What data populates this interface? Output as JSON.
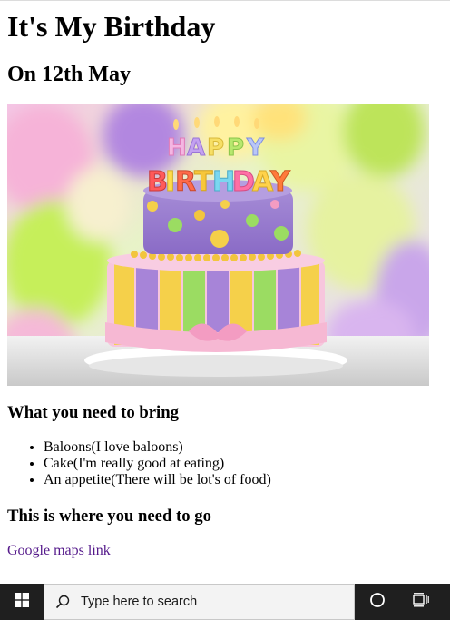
{
  "page": {
    "title": "It's My Birthday",
    "subtitle": "On 12th May",
    "image": {
      "alt": "Birthday cake with HAPPY BIRTHDAY candles",
      "candles_line1": "HAPPY",
      "candles_line2": "BIRTHDAY"
    },
    "bring_heading": "What you need to bring",
    "bring_items": [
      "Baloons(I love baloons)",
      "Cake(I'm really good at eating)",
      "An appetite(There will be lot's of food)"
    ],
    "go_heading": "This is where you need to go",
    "maps_link": "Google maps link"
  },
  "taskbar": {
    "search_placeholder": "Type here to search",
    "icons": [
      "windows-start-icon",
      "search-icon",
      "cortana-icon",
      "task-view-icon"
    ]
  },
  "colors": {
    "taskbar_bg": "#1f1f1f",
    "link_visited": "#551a8b",
    "search_bg": "#f3f3f3"
  }
}
